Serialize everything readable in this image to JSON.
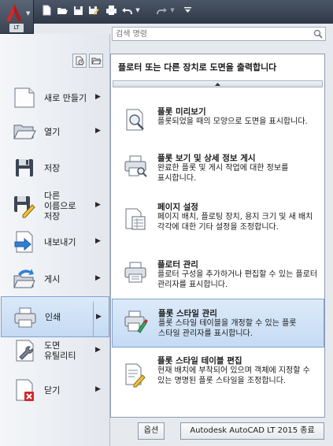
{
  "app": {
    "badge": "LT"
  },
  "search": {
    "placeholder": "검색 명령"
  },
  "quick_access": [
    "new-icon",
    "open-icon",
    "save-icon",
    "save-as-icon",
    "print-icon",
    "undo-icon",
    "undo-dropdown-icon",
    "redo-icon",
    "redo-dropdown-icon",
    "customize-dropdown-icon"
  ],
  "menu": {
    "items": [
      {
        "label": "새로 만들기",
        "has_arrow": true
      },
      {
        "label": "열기",
        "has_arrow": true
      },
      {
        "label": "저장",
        "has_arrow": false
      },
      {
        "label": "다른 이름으로 저장",
        "has_arrow": true
      },
      {
        "label": "내보내기",
        "has_arrow": true
      },
      {
        "label": "게시",
        "has_arrow": true
      },
      {
        "label": "인쇄",
        "has_arrow": true,
        "selected": true
      },
      {
        "label": "도면 유틸리티",
        "has_arrow": true
      },
      {
        "label": "닫기",
        "has_arrow": true
      }
    ]
  },
  "panel": {
    "title": "플로터 또는 다른 장치로 도면을 출력합니다",
    "items": [
      {
        "title": "플롯 미리보기",
        "desc": "플롯되었을 때의 모양으로 도면을 표시합니다."
      },
      {
        "title": "플롯 보기 및 상세 정보 게시",
        "desc": "완료한 플롯 및 게시 작업에 대한 정보를 표시합니다."
      },
      {
        "title": "페이지 설정",
        "desc": "페이지 배치, 플로팅 장치, 용지 크기 및 새 배치 각각에 대한 기타 설정을 조정합니다."
      },
      {
        "title": "플로터 관리",
        "desc": "플로터 구성을 추가하거나 편집할 수 있는 플로터 관리자를 표시합니다."
      },
      {
        "title": "플롯 스타일 관리",
        "desc": "플롯 스타일 테이블을 개정할 수 있는 플롯 스타일 관리자를 표시합니다.",
        "selected": true
      },
      {
        "title": "플롯 스타일 테이블 편집",
        "desc": "현재 배치에 부착되어 있으며 객체에 지정할 수 있는 명명된 플롯 스타일을 조정합니다."
      }
    ]
  },
  "footer": {
    "options_label": "옵션",
    "exit_label": "Autodesk AutoCAD LT 2015 종료"
  }
}
